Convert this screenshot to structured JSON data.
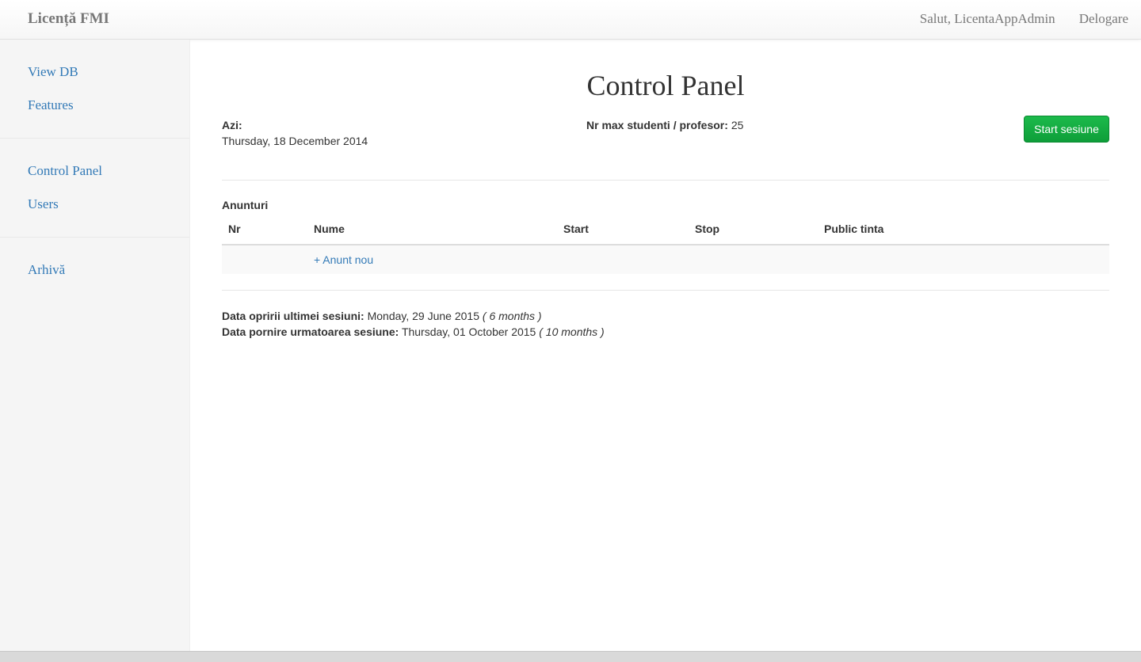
{
  "navbar": {
    "brand": "Licență FMI",
    "greeting": "Salut, LicentaAppAdmin",
    "logout": "Delogare"
  },
  "sidebar": {
    "groups": [
      [
        "View DB",
        "Features"
      ],
      [
        "Control Panel",
        "Users"
      ],
      [
        "Arhivă"
      ]
    ]
  },
  "main": {
    "title": "Control Panel",
    "today_label": "Azi:",
    "today_value": "Thursday, 18 December 2014",
    "max_label": "Nr max studenti / profesor:",
    "max_value": "25",
    "start_button": "Start sesiune",
    "announcements_label": "Anunturi",
    "table_headers": [
      "Nr",
      "Nume",
      "Start",
      "Stop",
      "Public tinta"
    ],
    "new_announcement": "+ Anunt nou",
    "last_stop_label": "Data opririi ultimei sesiuni:",
    "last_stop_value": "Monday, 29 June 2015",
    "last_stop_relative": "( 6 months )",
    "next_start_label": "Data pornire urmatoarea sesiune:",
    "next_start_value": "Thursday, 01 October 2015",
    "next_start_relative": "( 10 months )"
  },
  "colors": {
    "link": "#337ab7",
    "button": "#15ab43",
    "sidebar_bg": "#f5f5f5"
  }
}
